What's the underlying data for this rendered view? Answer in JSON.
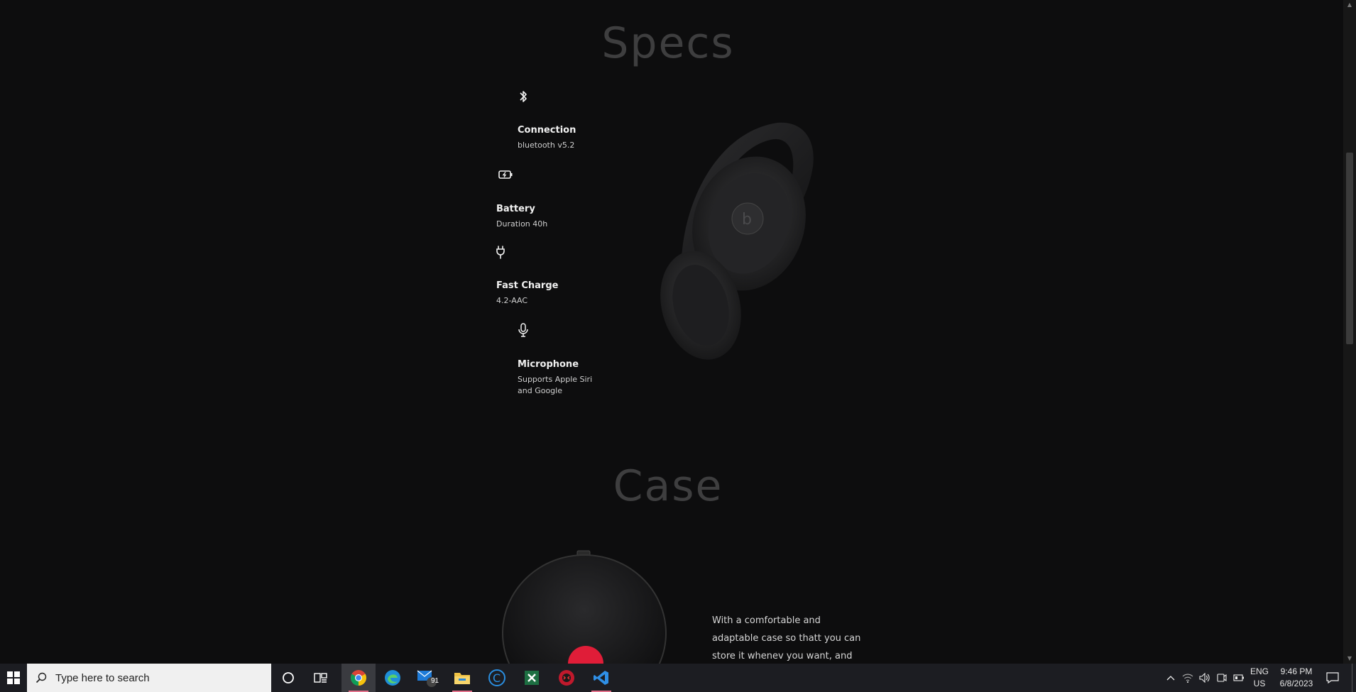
{
  "sections": {
    "specs_title": "Specs",
    "case_title": "Case"
  },
  "specs": [
    {
      "title": "Connection",
      "desc": "bluetooth v5.2",
      "icon": "bluetooth-icon"
    },
    {
      "title": "Battery",
      "desc": "Duration 40h",
      "icon": "battery-charging-icon"
    },
    {
      "title": "Fast Charge",
      "desc": "4.2-AAC",
      "icon": "plug-icon"
    },
    {
      "title": "Microphone",
      "desc": "Supports Apple Siri and Google",
      "icon": "microphone-icon"
    }
  ],
  "case": {
    "description": "With a comfortable and adaptable case so thatt you can store it whenev you want, and"
  },
  "taskbar": {
    "search_placeholder": "Type here to search",
    "mail_badge": "91",
    "language_primary": "ENG",
    "language_secondary": "US",
    "time": "9:46 PM",
    "date": "6/8/2023",
    "apps": [
      "chrome-icon",
      "edge-icon",
      "mail-icon",
      "file-explorer-icon",
      "ccleaner-icon",
      "excel-icon",
      "game-app-icon",
      "vscode-icon"
    ]
  },
  "colors": {
    "background": "#0d0d0e",
    "title_gray": "#3e3e3f",
    "taskbar": "#1c1d22",
    "accent_red": "#e01d38",
    "vscode_blue": "#2f8fe6"
  }
}
